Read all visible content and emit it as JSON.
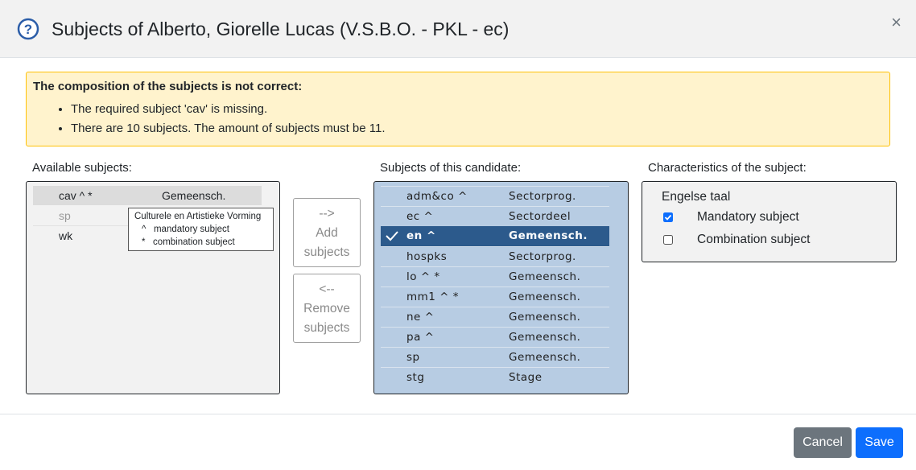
{
  "dialog": {
    "title": "Subjects of Alberto, Giorelle Lucas (V.S.B.O. - PKL - ec)",
    "close_label": "×"
  },
  "alert": {
    "title": "The composition of the subjects is not correct:",
    "messages": [
      "The required subject 'cav' is missing.",
      "There are 10 subjects. The amount of subjects must be 11."
    ]
  },
  "available": {
    "label": "Available subjects:",
    "rows": [
      {
        "code": "cav ^ *",
        "sector": "Gemeensch."
      },
      {
        "code": "sp",
        "sector": ""
      },
      {
        "code": "wk",
        "sector": ""
      }
    ],
    "tooltip": {
      "title": "Culturele en Artistieke Vorming",
      "line1": "^   mandatory subject",
      "line2": "*   combination subject"
    }
  },
  "buttons": {
    "add_arrow": "-->",
    "add_line1": "Add",
    "add_line2": "subjects",
    "remove_arrow": "<--",
    "remove_line1": "Remove",
    "remove_line2": "subjects",
    "cancel": "Cancel",
    "save": "Save"
  },
  "candidate": {
    "label": "Subjects of this candidate:",
    "rows": [
      {
        "code": "adm&co ^",
        "sector": "Sectorprog."
      },
      {
        "code": "ec ^",
        "sector": "Sectordeel"
      },
      {
        "code": "en ^",
        "sector": "Gemeensch."
      },
      {
        "code": "hospks",
        "sector": "Sectorprog."
      },
      {
        "code": "lo ^ *",
        "sector": "Gemeensch."
      },
      {
        "code": "mm1 ^ *",
        "sector": "Gemeensch."
      },
      {
        "code": "ne ^",
        "sector": "Gemeensch."
      },
      {
        "code": "pa ^",
        "sector": "Gemeensch."
      },
      {
        "code": "sp",
        "sector": "Gemeensch."
      },
      {
        "code": "stg",
        "sector": "Stage"
      }
    ],
    "selected_index": 2
  },
  "characteristics": {
    "label": "Characteristics of the subject:",
    "subject_name": "Engelse taal",
    "mandatory_label": "Mandatory subject",
    "mandatory_checked": true,
    "combination_label": "Combination subject",
    "combination_checked": false
  },
  "colors": {
    "accent": "#0d6efd",
    "selected_row": "#2c5a8c",
    "candidate_bg": "#b7cce3",
    "alert_bg": "#fff3cd",
    "alert_border": "#ffc107"
  },
  "icons": {
    "help": "question-circle-icon",
    "check": "checkmark-icon",
    "close": "close-icon"
  }
}
